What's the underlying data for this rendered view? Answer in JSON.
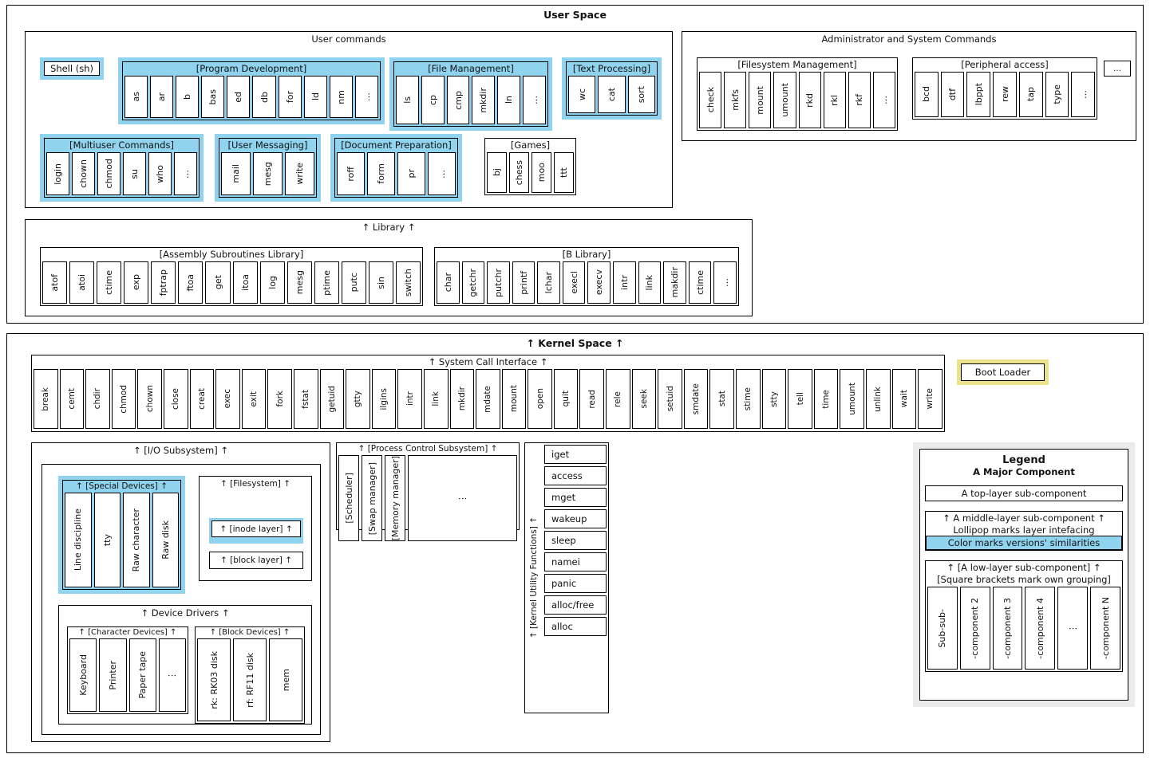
{
  "user_space": {
    "title": "User Space",
    "user_commands": {
      "title": "User commands",
      "shell": "Shell (sh)",
      "program_development": {
        "title": "[Program Development]",
        "items": [
          "as",
          "ar",
          "b",
          "bas",
          "ed",
          "db",
          "for",
          "ld",
          "nm",
          "…"
        ]
      },
      "file_management": {
        "title": "[File Management]",
        "items": [
          "ls",
          "cp",
          "cmp",
          "mkdir",
          "ln",
          "…"
        ]
      },
      "text_processing": {
        "title": "[Text Processing]",
        "items": [
          "wc",
          "cat",
          "sort"
        ]
      },
      "multiuser_commands": {
        "title": "[Multiuser Commands]",
        "items": [
          "login",
          "chown",
          "chmod",
          "su",
          "who",
          "…"
        ]
      },
      "user_messaging": {
        "title": "[User Messaging]",
        "items": [
          "mail",
          "mesg",
          "write"
        ]
      },
      "document_preparation": {
        "title": "[Document Preparation]",
        "items": [
          "roff",
          "form",
          "pr",
          "…"
        ]
      },
      "games": {
        "title": "[Games]",
        "items": [
          "bj",
          "chess",
          "moo",
          "ttt"
        ]
      }
    },
    "admin_commands": {
      "title": "Administrator and System Commands",
      "filesystem_management": {
        "title": "[Filesystem Management]",
        "items": [
          "check",
          "mkfs",
          "mount",
          "umount",
          "rkd",
          "rkl",
          "rkf",
          "…"
        ],
        "highlighted": [
          "mkfs",
          "mount",
          "umount"
        ]
      },
      "peripheral_access": {
        "title": "[Peripheral access]",
        "items": [
          "bcd",
          "dtf",
          "lbppt",
          "rew",
          "tap",
          "type",
          "…"
        ]
      },
      "more": "…"
    },
    "library": {
      "title": "↑ Library ↑",
      "assembly": {
        "title": "[Assembly Subroutines Library]",
        "items": [
          "atof",
          "atoi",
          "ctime",
          "exp",
          "fptrap",
          "ftoa",
          "get",
          "itoa",
          "log",
          "mesg",
          "ptime",
          "putc",
          "sin",
          "switch"
        ],
        "highlighted": [
          "atof",
          "atoi",
          "ctime",
          "exp",
          "log",
          "putc",
          "sin"
        ]
      },
      "b_library": {
        "title": "[B Library]",
        "items": [
          "char",
          "getchr",
          "putchr",
          "printf",
          "lchar",
          "execl",
          "execv",
          "intr",
          "link",
          "makdir",
          "ctime",
          "…"
        ],
        "highlighted": [
          "getchr",
          "putchr",
          "printf",
          "execl",
          "execv",
          "ctime"
        ]
      }
    }
  },
  "kernel_space": {
    "title": "↑ Kernel Space ↑",
    "boot_loader": "Boot Loader",
    "system_call_interface": {
      "title": "↑ System Call Interface ↑",
      "items": [
        "break",
        "cemt",
        "chdir",
        "chmod",
        "chown",
        "close",
        "creat",
        "exec",
        "exit",
        "fork",
        "fstat",
        "getuid",
        "gtty",
        "ilgins",
        "intr",
        "link",
        "mkdir",
        "mdate",
        "mount",
        "open",
        "quit",
        "read",
        "rele",
        "seek",
        "setuid",
        "smdate",
        "stat",
        "stime",
        "stty",
        "tell",
        "time",
        "umount",
        "unlink",
        "wait",
        "write"
      ],
      "highlighted": [
        "break",
        "chdir",
        "chmod",
        "chown",
        "close",
        "creat",
        "exec",
        "exit",
        "fork",
        "fstat",
        "getuid",
        "link",
        "mkdir",
        "mount",
        "open",
        "read",
        "seek",
        "setuid",
        "stat",
        "stty",
        "tell",
        "umount",
        "unlink",
        "wait",
        "write"
      ]
    },
    "io_subsystem": {
      "title": "↑ [I/O Subsystem] ↑",
      "special_devices": {
        "title": "↑ [Special Devices] ↑",
        "items": [
          "Line discipline",
          "tty",
          "Raw character",
          "Raw disk"
        ]
      },
      "filesystem": {
        "title": "↑ [Filesystem] ↑",
        "inode_layer": "↑ [inode layer] ↑",
        "block_layer": "↑ [block layer] ↑"
      },
      "device_drivers": {
        "title": "↑ Device Drivers ↑",
        "character_devices": {
          "title": "↑ [Character Devices] ↑",
          "items": [
            "Keyboard",
            "Printer",
            "Paper tape",
            "⋮"
          ],
          "highlighted": [
            "Keyboard",
            "Printer"
          ]
        },
        "block_devices": {
          "title": "↑ [Block Devices] ↑",
          "items": [
            "rk: RK03 disk",
            "rf: RF11 disk",
            "mem"
          ]
        }
      }
    },
    "process_control_subsystem": {
      "title": "↑ [Process Control Subsystem] ↑",
      "items": [
        "[Scheduler]",
        "[Swap manager]",
        "[Memory manager]",
        "⋮"
      ],
      "highlighted": [
        "[Scheduler]",
        "[Memory manager]"
      ]
    },
    "kernel_utility_functions": {
      "title": "↑ [Kernel Utility Functions] ↑",
      "items": [
        "iget",
        "access",
        "mget",
        "wakeup",
        "sleep",
        "namei",
        "panic",
        "alloc/free",
        "alloc"
      ],
      "highlighted": [
        "wakeup",
        "namei",
        "panic"
      ]
    },
    "legend": {
      "title": "Legend",
      "subtitle": "A Major Component",
      "top_layer": "A top-layer sub-component",
      "middle_layer_line1": "↑ A middle-layer sub-component ↑",
      "middle_layer_line2": "Lollipop marks layer intefacing",
      "middle_layer_line3": "Color marks versions' similarities",
      "low_layer_line1": "↑ [A low-layer sub-component] ↑",
      "low_layer_line2": "[Square brackets mark own grouping]",
      "components": [
        "Sub-sub-",
        "-component 2",
        "-component 3",
        "-component 4",
        "⋮",
        "-component N"
      ]
    }
  },
  "colors": {
    "blue": "#8fd3ef",
    "green": "#90ee90",
    "pink": "#ffb3c1",
    "purple": "#dda0dd",
    "orange": "#fadcb3",
    "yellow": "#ece28c",
    "grey": "#ebebeb"
  }
}
